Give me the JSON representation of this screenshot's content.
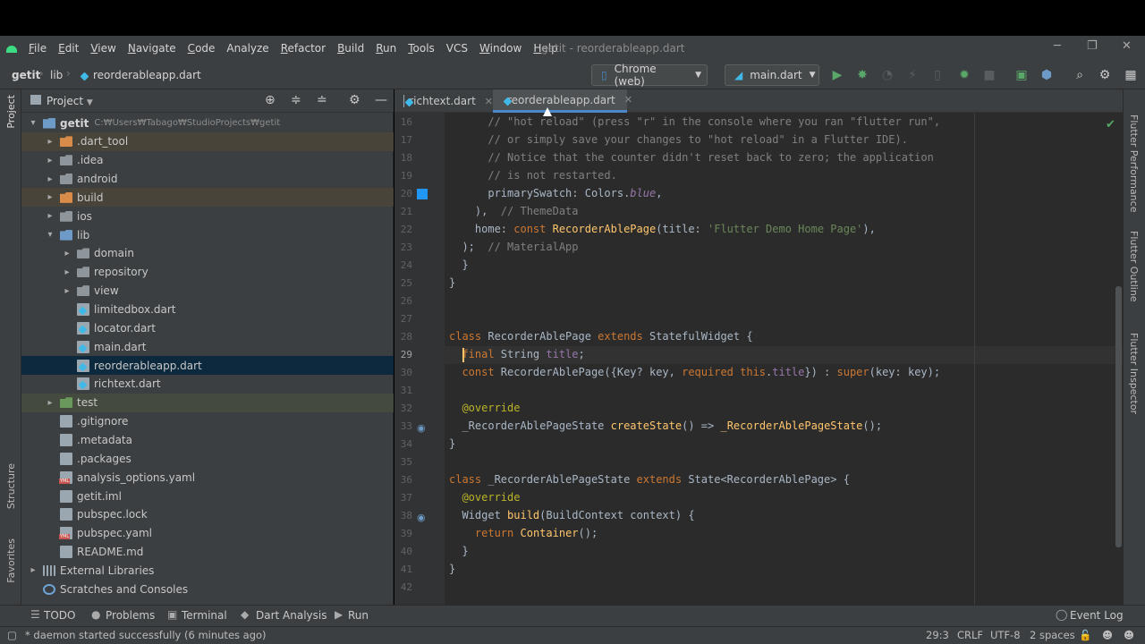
{
  "window": {
    "title": "getit - reorderableapp.dart",
    "minimize": "─",
    "restore": "❐",
    "close": "✕"
  },
  "menu": [
    {
      "label": "File",
      "mnemonic": "F",
      "rest": "ile"
    },
    {
      "label": "Edit",
      "mnemonic": "E",
      "rest": "dit"
    },
    {
      "label": "View",
      "mnemonic": "V",
      "rest": "iew"
    },
    {
      "label": "Navigate",
      "mnemonic": "N",
      "rest": "avigate"
    },
    {
      "label": "Code",
      "mnemonic": "C",
      "rest": "ode"
    },
    {
      "label": "Analyze",
      "mnemonic": "",
      "rest": "Analyze"
    },
    {
      "label": "Refactor",
      "mnemonic": "R",
      "rest": "efactor"
    },
    {
      "label": "Build",
      "mnemonic": "B",
      "rest": "uild"
    },
    {
      "label": "Run",
      "mnemonic": "R",
      "rest": "un"
    },
    {
      "label": "Tools",
      "mnemonic": "T",
      "rest": "ools"
    },
    {
      "label": "VCS",
      "mnemonic": "",
      "rest": "VCS"
    },
    {
      "label": "Window",
      "mnemonic": "W",
      "rest": "indow"
    },
    {
      "label": "Help",
      "mnemonic": "H",
      "rest": "elp"
    }
  ],
  "breadcrumb": {
    "project": "getit",
    "folder": "lib",
    "file": "reorderableapp.dart"
  },
  "toolbar": {
    "device": "Chrome (web)",
    "run_config": "main.dart"
  },
  "project_panel": {
    "title": "Project",
    "tree": [
      {
        "label": "getit",
        "path": "C:₩Users₩Tabago₩StudioProjects₩getit",
        "level": 0,
        "arrow": "▾",
        "icon": "folder-blue",
        "style": "bold"
      },
      {
        "label": ".dart_tool",
        "level": 1,
        "arrow": "▸",
        "icon": "folder-orange",
        "style": "excluded"
      },
      {
        "label": ".idea",
        "level": 1,
        "arrow": "▸",
        "icon": "folder",
        "style": ""
      },
      {
        "label": "android",
        "level": 1,
        "arrow": "▸",
        "icon": "folder",
        "style": ""
      },
      {
        "label": "build",
        "level": 1,
        "arrow": "▸",
        "icon": "folder-orange",
        "style": "excluded"
      },
      {
        "label": "ios",
        "level": 1,
        "arrow": "▸",
        "icon": "folder",
        "style": ""
      },
      {
        "label": "lib",
        "level": 1,
        "arrow": "▾",
        "icon": "folder-blue",
        "style": ""
      },
      {
        "label": "domain",
        "level": 2,
        "arrow": "▸",
        "icon": "folder",
        "style": ""
      },
      {
        "label": "repository",
        "level": 2,
        "arrow": "▸",
        "icon": "folder",
        "style": ""
      },
      {
        "label": "view",
        "level": 2,
        "arrow": "▸",
        "icon": "folder",
        "style": ""
      },
      {
        "label": "limitedbox.dart",
        "level": 2,
        "arrow": "",
        "icon": "dart",
        "style": ""
      },
      {
        "label": "locator.dart",
        "level": 2,
        "arrow": "",
        "icon": "dart",
        "style": ""
      },
      {
        "label": "main.dart",
        "level": 2,
        "arrow": "",
        "icon": "dart",
        "style": ""
      },
      {
        "label": "reorderableapp.dart",
        "level": 2,
        "arrow": "",
        "icon": "dart",
        "style": "selected"
      },
      {
        "label": "richtext.dart",
        "level": 2,
        "arrow": "",
        "icon": "dart",
        "style": ""
      },
      {
        "label": "test",
        "level": 1,
        "arrow": "▸",
        "icon": "folder-green",
        "style": "testrow"
      },
      {
        "label": ".gitignore",
        "level": 1,
        "arrow": "",
        "icon": "file",
        "style": ""
      },
      {
        "label": ".metadata",
        "level": 1,
        "arrow": "",
        "icon": "file",
        "style": ""
      },
      {
        "label": ".packages",
        "level": 1,
        "arrow": "",
        "icon": "file",
        "style": ""
      },
      {
        "label": "analysis_options.yaml",
        "level": 1,
        "arrow": "",
        "icon": "yaml",
        "style": ""
      },
      {
        "label": "getit.iml",
        "level": 1,
        "arrow": "",
        "icon": "file",
        "style": ""
      },
      {
        "label": "pubspec.lock",
        "level": 1,
        "arrow": "",
        "icon": "file",
        "style": ""
      },
      {
        "label": "pubspec.yaml",
        "level": 1,
        "arrow": "",
        "icon": "yaml",
        "style": ""
      },
      {
        "label": "README.md",
        "level": 1,
        "arrow": "",
        "icon": "file",
        "style": ""
      },
      {
        "label": "External Libraries",
        "level": 0,
        "arrow": "▸",
        "icon": "lib",
        "style": ""
      },
      {
        "label": "Scratches and Consoles",
        "level": 0,
        "arrow": "",
        "icon": "scratch",
        "style": ""
      }
    ]
  },
  "tabs": [
    {
      "label": "richtext.dart",
      "active": false
    },
    {
      "label": "reorderableapp.dart",
      "active": true
    }
  ],
  "editor": {
    "current_line": "29",
    "lines": [
      {
        "n": "16",
        "html": "      <span class='cm'>// \"hot reload\" (press \"r\" in the console where you ran \"flutter run\",</span>"
      },
      {
        "n": "17",
        "html": "      <span class='cm'>// or simply save your changes to \"hot reload\" in a Flutter IDE).</span>"
      },
      {
        "n": "18",
        "html": "      <span class='cm'>// Notice that the counter didn't reset back to zero; the application</span>"
      },
      {
        "n": "19",
        "html": "      <span class='cm'>// is not restarted.</span>"
      },
      {
        "n": "20",
        "html": "      primarySwatch: Colors.<span class='it'>blue</span>,"
      },
      {
        "n": "21",
        "html": "    ),  <span class='cm'>// ThemeData</span>"
      },
      {
        "n": "22",
        "html": "    home: <span class='kw'>const</span> <span class='fn'>RecorderAblePage</span>(title: <span class='st'>'Flutter Demo Home Page'</span>),"
      },
      {
        "n": "23",
        "html": "  );  <span class='cm'>// MaterialApp</span>"
      },
      {
        "n": "24",
        "html": "  }"
      },
      {
        "n": "25",
        "html": "}"
      },
      {
        "n": "26",
        "html": ""
      },
      {
        "n": "27",
        "html": ""
      },
      {
        "n": "28",
        "html": "<span class='kw'>class</span> RecorderAblePage <span class='kw'>extends</span> StatefulWidget {"
      },
      {
        "n": "29",
        "html": "  <span class='kw'>final</span> String <span class='fd'>title</span>;"
      },
      {
        "n": "30",
        "html": "  <span class='kw'>const</span> RecorderAblePage({Key? key, <span class='kw'>required this</span>.<span class='fd'>title</span>}) : <span class='kw'>super</span>(key: key);"
      },
      {
        "n": "31",
        "html": ""
      },
      {
        "n": "32",
        "html": "  <span class='an'>@override</span>"
      },
      {
        "n": "33",
        "html": "  _RecorderAblePageState <span class='fn'>createState</span>() =&gt; <span class='fn'>_RecorderAblePageState</span>();"
      },
      {
        "n": "34",
        "html": "}"
      },
      {
        "n": "35",
        "html": ""
      },
      {
        "n": "36",
        "html": "<span class='kw'>class</span> _RecorderAblePageState <span class='kw'>extends</span> State&lt;RecorderAblePage&gt; {"
      },
      {
        "n": "37",
        "html": "  <span class='an'>@override</span>"
      },
      {
        "n": "38",
        "html": "  Widget <span class='fn'>build</span>(BuildContext context) {"
      },
      {
        "n": "39",
        "html": "    <span class='kw'>return</span> <span class='fn'>Container</span>();"
      },
      {
        "n": "40",
        "html": "  }"
      },
      {
        "n": "41",
        "html": "}"
      },
      {
        "n": "42",
        "html": ""
      }
    ]
  },
  "left_strip": {
    "project": "Project",
    "structure": "Structure",
    "favorites": "Favorites"
  },
  "right_strip": {
    "performance": "Flutter Performance",
    "outline": "Flutter Outline",
    "inspector": "Flutter Inspector"
  },
  "bottom_tools": [
    {
      "label": "TODO",
      "icon": "list-icon"
    },
    {
      "label": "Problems",
      "icon": "problems-icon"
    },
    {
      "label": "Terminal",
      "icon": "terminal-icon"
    },
    {
      "label": "Dart Analysis",
      "icon": "dart-analysis-icon"
    },
    {
      "label": "Run",
      "icon": "run-icon"
    }
  ],
  "event_log": "Event Log",
  "status": {
    "message": "* daemon started successfully (6 minutes ago)",
    "position": "29:3",
    "line_sep": "CRLF",
    "encoding": "UTF-8",
    "indent": "2 spaces"
  },
  "colors": {
    "accent": "#4a88c7",
    "dart": "#40b9e8",
    "run_green": "#59a869",
    "selection": "#0d293e"
  }
}
